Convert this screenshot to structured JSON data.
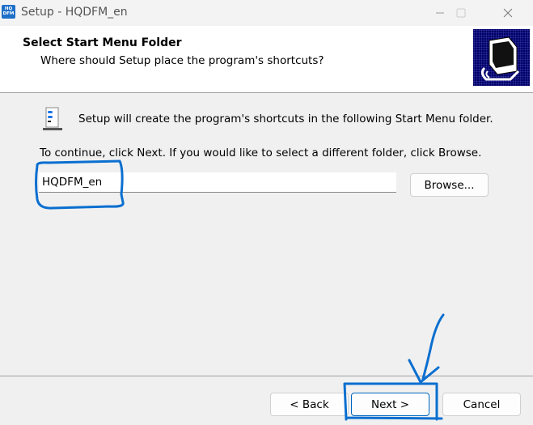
{
  "window": {
    "app_icon_text_line1": "HQ",
    "app_icon_text_line2": "DFM",
    "title": "Setup - HQDFM_en",
    "controls": {
      "minimize": "—",
      "maximize": "☐",
      "close": "✕"
    }
  },
  "header": {
    "title": "Select Start Menu Folder",
    "subtitle": "Where should Setup place the program's shortcuts?"
  },
  "body": {
    "info_text": "Setup will create the program's shortcuts in the following Start Menu folder.",
    "instruction": "To continue, click Next. If you would like to select a different folder, click Browse.",
    "folder_value": "HQDFM_en",
    "browse_label": "Browse..."
  },
  "footer": {
    "back_label": "< Back",
    "next_label": "Next >",
    "cancel_label": "Cancel"
  },
  "annotations": {
    "color": "#0a6fd0",
    "items": [
      "circle-around-folder-input",
      "arrow-to-next-button",
      "box-around-next-button"
    ]
  }
}
